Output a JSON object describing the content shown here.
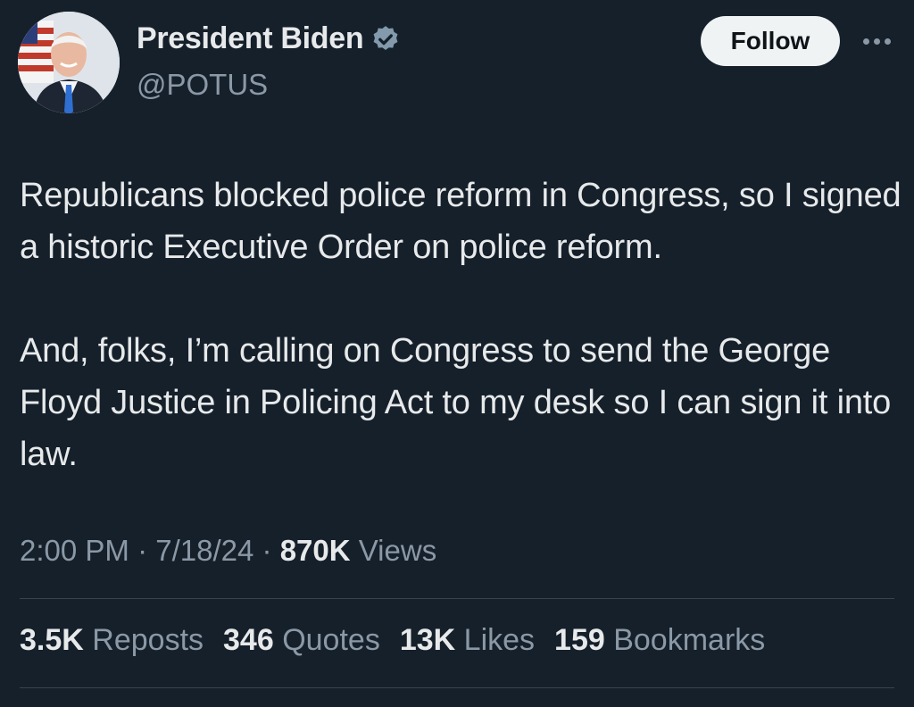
{
  "author": {
    "name": "President Biden",
    "handle": "@POTUS",
    "verified_color": "#829aab"
  },
  "actions": {
    "follow_label": "Follow"
  },
  "tweet": {
    "paragraph_1": "Republicans blocked police reform in Congress, so I signed a historic Executive Order on police reform.",
    "paragraph_2": "And, folks, I’m calling on Congress to send the George Floyd Justice in Policing Act to my desk so I can sign it into law."
  },
  "meta": {
    "time": "2:00 PM",
    "date": "7/18/24",
    "views_count": "870K",
    "views_label": "Views"
  },
  "stats": {
    "reposts_count": "3.5K",
    "reposts_label": "Reposts",
    "quotes_count": "346",
    "quotes_label": "Quotes",
    "likes_count": "13K",
    "likes_label": "Likes",
    "bookmarks_count": "159",
    "bookmarks_label": "Bookmarks"
  },
  "colors": {
    "background": "#15202b",
    "text": "#e7e9ea",
    "secondary_text": "#8b98a5",
    "divider": "#38444d"
  }
}
